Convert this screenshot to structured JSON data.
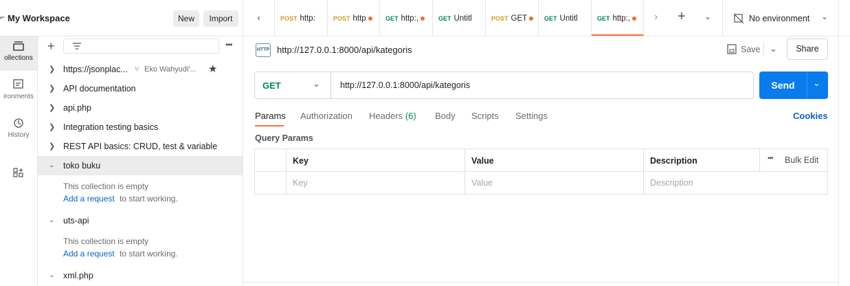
{
  "workspace": {
    "title": "My Workspace",
    "new_label": "New",
    "import_label": "Import"
  },
  "rail": {
    "items": [
      {
        "label": "ollections",
        "icon": "collections-icon"
      },
      {
        "label": "ironments",
        "icon": "environments-icon"
      },
      {
        "label": "History",
        "icon": "history-icon"
      },
      {
        "label": "",
        "icon": "apps-icon"
      }
    ]
  },
  "tree": {
    "items": [
      {
        "label": "https://jsonplac...",
        "fork": "Eko Wahyudi'...",
        "expanded": false
      },
      {
        "label": "API documentation",
        "expanded": false
      },
      {
        "label": "api.php",
        "expanded": false
      },
      {
        "label": "Integration testing basics",
        "expanded": false
      },
      {
        "label": "REST API basics: CRUD, test & variable",
        "expanded": false
      },
      {
        "label": "toko buku",
        "expanded": true
      },
      {
        "label": "uts-api",
        "expanded": true
      },
      {
        "label": "xml.php",
        "expanded": true
      }
    ],
    "empty_note": "This collection is empty",
    "add_request": "Add a request",
    "to_start": "to start working."
  },
  "tabs": [
    {
      "method": "POST",
      "label": "http:",
      "dot": false
    },
    {
      "method": "POST",
      "label": "http",
      "dot": true
    },
    {
      "method": "GET",
      "label": "http:,",
      "dot": true
    },
    {
      "method": "GET",
      "label": "Untitl",
      "dot": false
    },
    {
      "method": "POST",
      "label": "GET",
      "dot": true
    },
    {
      "method": "GET",
      "label": "Untitl",
      "dot": false
    },
    {
      "method": "GET",
      "label": "http:,",
      "dot": true,
      "active": true
    }
  ],
  "environment": {
    "label": "No environment"
  },
  "request": {
    "badge": "HTTP",
    "title": "http://127.0.0.1:8000/api/kategoris",
    "save_label": "Save",
    "share_label": "Share",
    "method": "GET",
    "url": "http://127.0.0.1:8000/api/kategoris",
    "send_label": "Send"
  },
  "subtabs": {
    "params": "Params",
    "authorization": "Authorization",
    "headers": "Headers",
    "headers_count": "(6)",
    "body": "Body",
    "scripts": "Scripts",
    "settings": "Settings",
    "cookies": "Cookies"
  },
  "query": {
    "heading": "Query Params",
    "columns": [
      "Key",
      "Value",
      "Description"
    ],
    "bulk_edit": "Bulk Edit",
    "placeholders": [
      "Key",
      "Value",
      "Description"
    ]
  },
  "colors": {
    "accent": "#097bed",
    "get": "#00875a",
    "post": "#d19a2b",
    "unsaved": "#ef6c35",
    "tab_active": "#ff6c37"
  }
}
